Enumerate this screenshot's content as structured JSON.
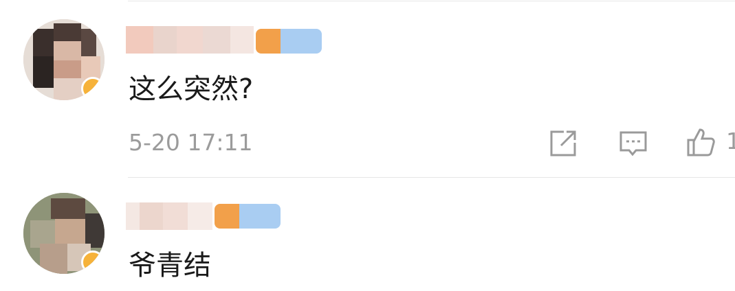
{
  "comments": [
    {
      "username_obscured": true,
      "text": "这么突然?",
      "time": "5-20 17:11",
      "actions": {
        "share_icon": "share-out-icon",
        "comment_icon": "comment-bubble-icon",
        "like_icon": "thumbs-up-icon",
        "like_count": "1"
      }
    },
    {
      "username_obscured": true,
      "text": "爷青结"
    }
  ],
  "colors": {
    "text": "#1a1a1a",
    "meta": "#9b9b9b",
    "icon": "#9a9a9a",
    "divider": "#e6e6e6",
    "vip_badge": "#f6b23a"
  }
}
